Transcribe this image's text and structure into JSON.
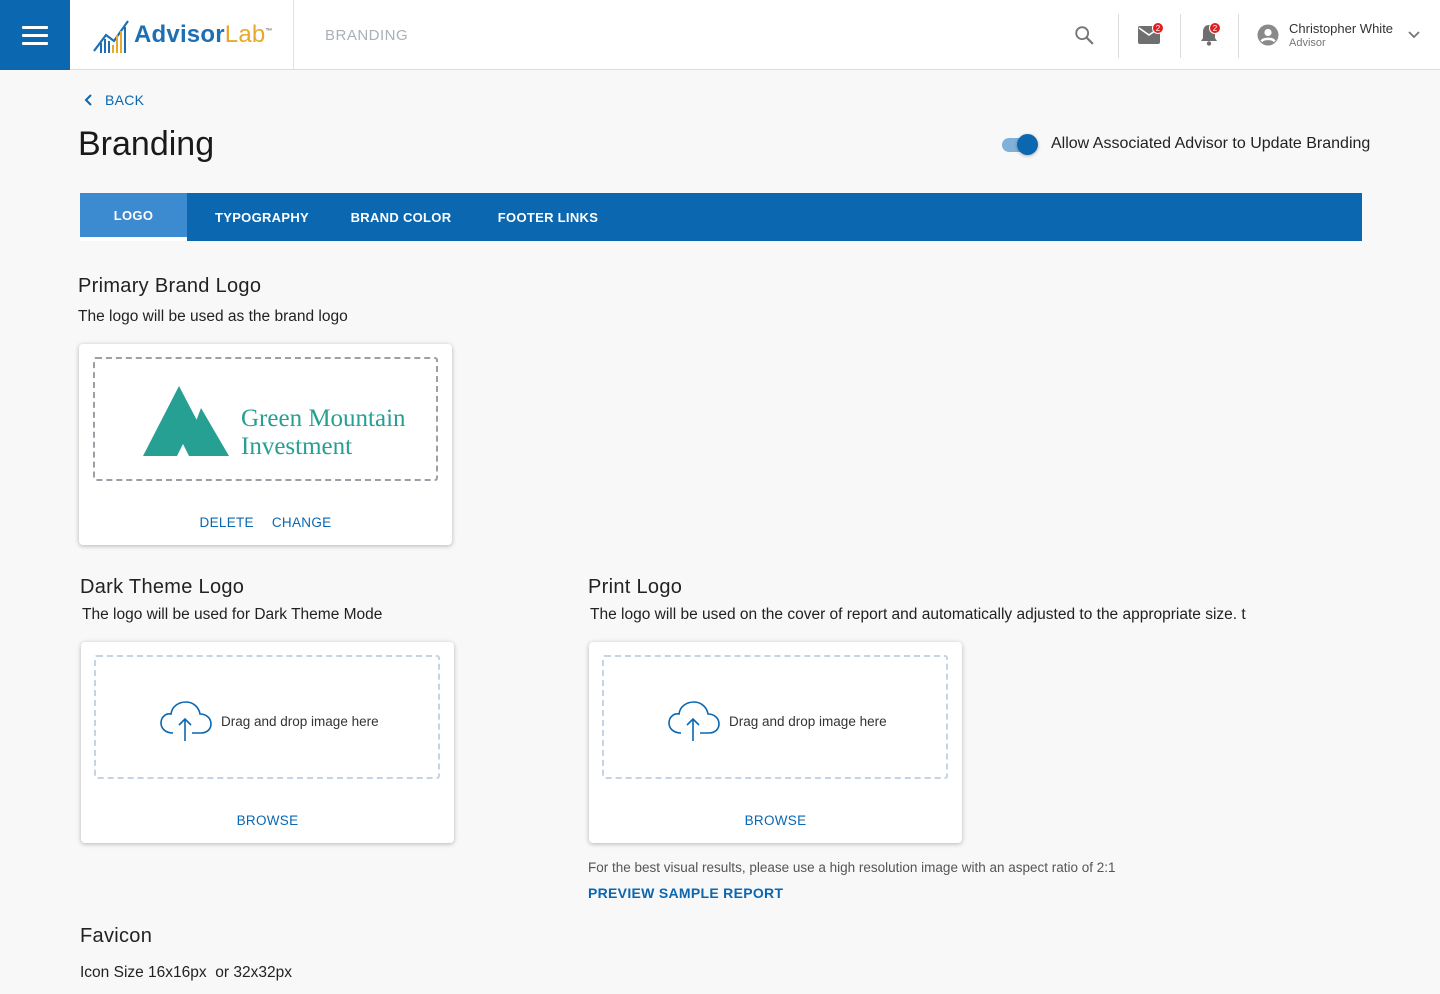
{
  "header": {
    "brand_part1": "Advisor",
    "brand_part2": "Lab",
    "brand_tm": "™",
    "page_crumb": "BRANDING",
    "mail_badge": "2",
    "notif_badge": "2",
    "user_name": "Christopher White",
    "user_role": "Advisor"
  },
  "nav": {
    "back_label": "BACK"
  },
  "page": {
    "title": "Branding",
    "toggle_label": "Allow Associated Advisor to Update Branding",
    "toggle_on": true
  },
  "tabs": [
    {
      "label": "LOGO",
      "active": true
    },
    {
      "label": "TYPOGRAPHY",
      "active": false
    },
    {
      "label": "BRAND COLOR",
      "active": false
    },
    {
      "label": "FOOTER LINKS",
      "active": false
    }
  ],
  "primary_logo": {
    "title": "Primary Brand Logo",
    "desc": "The logo will be used as the brand logo",
    "logo_line1": "Green Mountain",
    "logo_line2": "Investment",
    "delete_label": "DELETE",
    "change_label": "CHANGE"
  },
  "dark_logo": {
    "title": "Dark Theme Logo",
    "desc": "The logo will be used for Dark Theme Mode",
    "drop_text": "Drag and drop image here",
    "browse_label": "BROWSE"
  },
  "print_logo": {
    "title": "Print Logo",
    "desc": "The logo will be used on the cover of report and automatically adjusted to the appropriate size. t",
    "drop_text": "Drag and drop image here",
    "browse_label": "BROWSE",
    "hint": "For the best visual results, please use a high resolution image with an aspect ratio of 2:1",
    "preview_label": "PREVIEW SAMPLE REPORT"
  },
  "favicon": {
    "title": "Favicon",
    "desc": "Icon Size 16x16px  or 32x32px"
  },
  "colors": {
    "primary": "#0a67b0",
    "tab_active": "#3c8ad0",
    "logo_teal": "#26a092",
    "badge": "#e02020"
  }
}
